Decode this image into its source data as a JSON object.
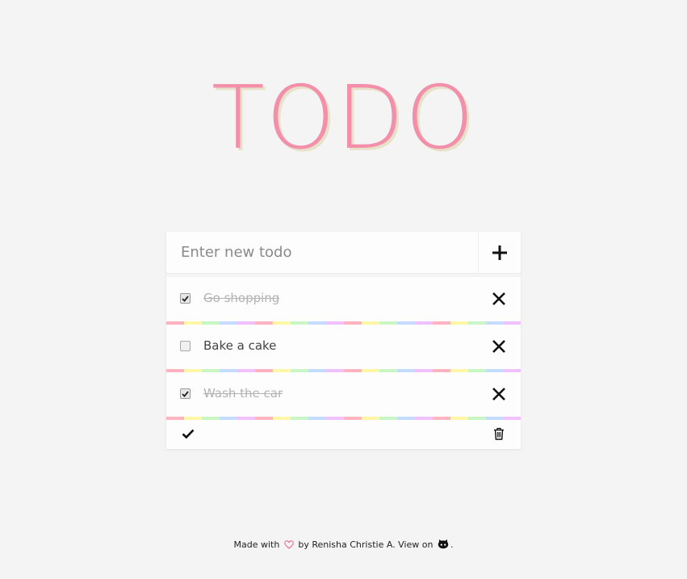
{
  "title": "TODO",
  "new_todo": {
    "placeholder": "Enter new todo",
    "value": "",
    "add_icon": "plus-icon"
  },
  "todos": [
    {
      "text": "Go shopping",
      "done": true
    },
    {
      "text": "Bake a cake",
      "done": false
    },
    {
      "text": "Wash the car",
      "done": true
    }
  ],
  "controls": {
    "check_all_icon": "checkmark-icon",
    "delete_all_icon": "trash-icon"
  },
  "footer": {
    "made_with": "Made with",
    "by": "by Renisha Christie A. View on",
    "end": "."
  },
  "colors": {
    "title": "#f48fab",
    "title_shadow": "#e6e1c8",
    "background": "#f4f4f4",
    "heart": "#f06a8d"
  }
}
